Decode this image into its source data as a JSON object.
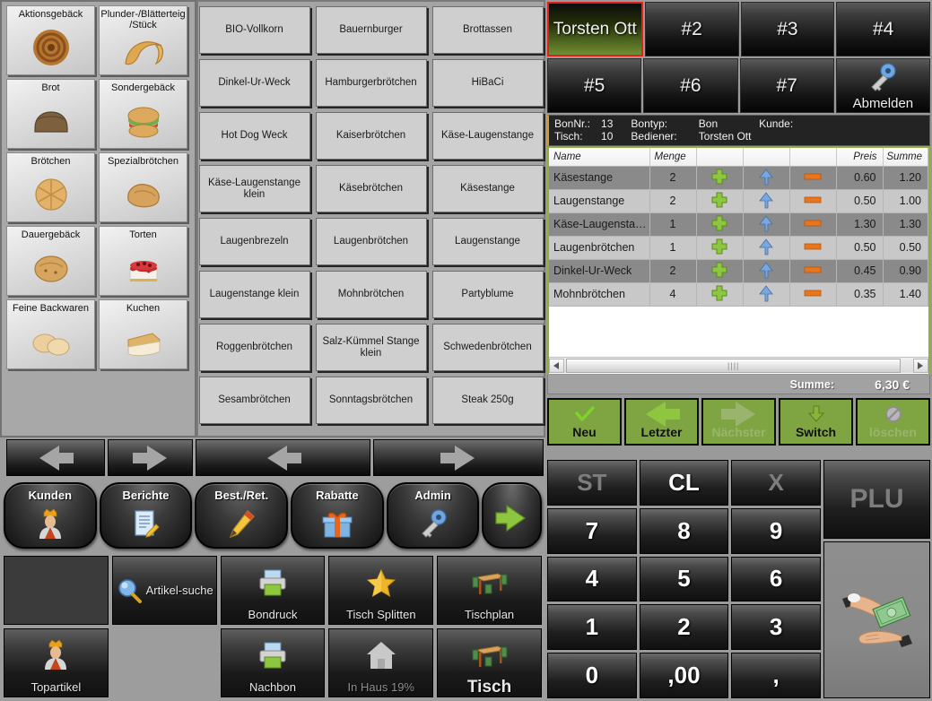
{
  "categories": [
    {
      "label": "Aktionsgebäck",
      "icon": "pastry-swirl-icon"
    },
    {
      "label": "Plunder-/Blätterteig/Stück",
      "icon": "croissant-icon"
    },
    {
      "label": "Brot",
      "icon": "bread-loaf-icon"
    },
    {
      "label": "Sondergebäck",
      "icon": "bagel-sandwich-icon"
    },
    {
      "label": "Brötchen",
      "icon": "kaiser-roll-icon"
    },
    {
      "label": "Spezialbrötchen",
      "icon": "rustic-roll-icon"
    },
    {
      "label": "Dauergebäck",
      "icon": "round-bread-icon"
    },
    {
      "label": "Torten",
      "icon": "cake-icon"
    },
    {
      "label": "Feine Backwaren",
      "icon": "donuts-icon"
    },
    {
      "label": "Kuchen",
      "icon": "cake-slice-icon"
    }
  ],
  "products": [
    "BIO-Vollkorn",
    "Bauernburger",
    "Brottassen",
    "Dinkel-Ur-Weck",
    "Hamburgerbrötchen",
    "HiBaCi",
    "Hot Dog Weck",
    "Kaiserbrötchen",
    "Käse-Laugenstange",
    "Käse-Laugenstange klein",
    "Käsebrötchen",
    "Käsestange",
    "Laugenbrezeln",
    "Laugenbrötchen",
    "Laugenstange",
    "Laugenstange klein",
    "Mohnbrötchen",
    "Partyblume",
    "Roggenbrötchen",
    "Salz-Kümmel Stange klein",
    "Schwedenbrötchen",
    "Sesambrötchen",
    "Sonntagsbrötchen",
    "Steak 250g"
  ],
  "nav_arrows": [
    {
      "name": "category-prev",
      "icon": "arrow-left-icon"
    },
    {
      "name": "category-next",
      "icon": "arrow-right-icon"
    },
    {
      "name": "product-prev",
      "icon": "arrow-left-icon"
    },
    {
      "name": "product-next",
      "icon": "arrow-right-icon"
    }
  ],
  "function_buttons": [
    {
      "label": "Kunden",
      "icon": "customer-icon"
    },
    {
      "label": "Berichte",
      "icon": "report-icon"
    },
    {
      "label": "Best./Ret.",
      "icon": "pencil-icon"
    },
    {
      "label": "Rabatte",
      "icon": "gift-icon"
    },
    {
      "label": "Admin",
      "icon": "key-icon"
    },
    {
      "label": "",
      "icon": "green-arrow-right-icon"
    }
  ],
  "function_grid": {
    "row1": [
      {
        "label": "",
        "icon": "",
        "kind": "empty"
      },
      {
        "label": "Artikel-suche",
        "icon": "magnifier-icon",
        "kind": "inline"
      },
      {
        "label": "Bondruck",
        "icon": "printer-icon",
        "kind": "normal"
      },
      {
        "label": "Tisch Splitten",
        "icon": "star-icon",
        "kind": "normal"
      },
      {
        "label": "Tischplan",
        "icon": "table-plan-icon",
        "kind": "normal"
      }
    ],
    "row2": [
      {
        "label": "Topartikel",
        "icon": "customer-icon",
        "kind": "normal"
      },
      {
        "label": "",
        "icon": "",
        "kind": "blank"
      },
      {
        "label": "Nachbon",
        "icon": "printer-icon",
        "kind": "normal"
      },
      {
        "label": "In Haus 19%",
        "icon": "house-icon",
        "kind": "disabled"
      },
      {
        "label": "Tisch",
        "icon": "table-plan-icon",
        "kind": "bold"
      }
    ]
  },
  "tabs": {
    "row1": [
      {
        "label": "Torsten Ott",
        "active": true
      },
      {
        "label": "#2",
        "active": false
      },
      {
        "label": "#3",
        "active": false
      },
      {
        "label": "#4",
        "active": false
      }
    ],
    "row2": [
      {
        "label": "#5",
        "active": false
      },
      {
        "label": "#6",
        "active": false
      },
      {
        "label": "#7",
        "active": false
      }
    ],
    "logout": {
      "label": "Abmelden",
      "icon": "key-icon"
    }
  },
  "bon_header": {
    "bonnr_label": "BonNr.:",
    "bonnr_value": "13",
    "bontyp_label": "Bontyp:",
    "bontyp_value": "Bon",
    "kunde_label": "Kunde:",
    "kunde_value": "",
    "tisch_label": "Tisch:",
    "tisch_value": "10",
    "bediener_label": "Bediener:",
    "bediener_value": "Torsten Ott"
  },
  "bon_table": {
    "columns": [
      "Name",
      "Menge",
      "",
      "",
      "",
      "Preis",
      "Summe"
    ],
    "rows": [
      {
        "name": "Käsestange",
        "menge": "2",
        "preis": "0.60",
        "summe": "1.20"
      },
      {
        "name": "Laugenstange",
        "menge": "2",
        "preis": "0.50",
        "summe": "1.00"
      },
      {
        "name": "Käse-Laugensta…",
        "menge": "1",
        "preis": "1.30",
        "summe": "1.30"
      },
      {
        "name": "Laugenbrötchen",
        "menge": "1",
        "preis": "0.50",
        "summe": "0.50"
      },
      {
        "name": "Dinkel-Ur-Weck",
        "menge": "2",
        "preis": "0.45",
        "summe": "0.90"
      },
      {
        "name": "Mohnbrötchen",
        "menge": "4",
        "preis": "0.35",
        "summe": "1.40"
      }
    ],
    "row_icons": {
      "add": "plus-icon",
      "up": "arrow-up-icon",
      "remove": "minus-icon"
    }
  },
  "summe": {
    "label": "Summe:",
    "value": "6,30 €"
  },
  "green_buttons": [
    {
      "label": "Neu",
      "icon": "check-icon",
      "disabled": false
    },
    {
      "label": "Letzter",
      "icon": "arrow-left-icon",
      "disabled": false
    },
    {
      "label": "Nächster",
      "icon": "arrow-right-icon",
      "disabled": true
    },
    {
      "label": "Switch",
      "icon": "arrow-down-icon",
      "disabled": false
    },
    {
      "label": "löschen",
      "icon": "forbidden-icon",
      "disabled": true
    }
  ],
  "keypad": {
    "keys": [
      {
        "label": "ST",
        "dim": true
      },
      {
        "label": "CL",
        "dim": false
      },
      {
        "label": "X",
        "dim": true
      },
      {
        "label": "7",
        "dim": false
      },
      {
        "label": "8",
        "dim": false
      },
      {
        "label": "9",
        "dim": false
      },
      {
        "label": "4",
        "dim": false
      },
      {
        "label": "5",
        "dim": false
      },
      {
        "label": "6",
        "dim": false
      },
      {
        "label": "1",
        "dim": false
      },
      {
        "label": "2",
        "dim": false
      },
      {
        "label": "3",
        "dim": false
      },
      {
        "label": "0",
        "dim": false
      },
      {
        "label": ",00",
        "dim": false
      },
      {
        "label": ",",
        "dim": false
      }
    ],
    "plu_label": "PLU",
    "pay_icon": "cash-hands-icon"
  },
  "colors": {
    "accent_green": "#7fa543",
    "table_border_green": "#8fb03f",
    "active_tab_border": "#e02020",
    "panel_gray": "#9d9d9d"
  }
}
